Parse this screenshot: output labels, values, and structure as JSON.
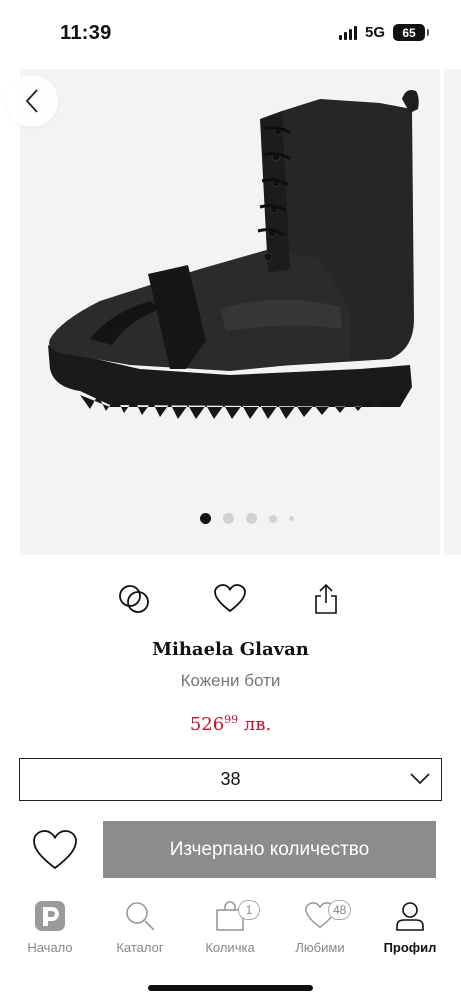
{
  "status_bar": {
    "time": "11:39",
    "network": "5G",
    "battery": "65"
  },
  "gallery": {
    "image_description_icon": "boot-image",
    "dots_count": 5,
    "active_dot": 0
  },
  "product": {
    "brand": "Mihaela Glavan",
    "name": "Кожени боти",
    "price_main": "526",
    "price_cents": "99",
    "price_currency": " лв.",
    "price_color": "#c8102e"
  },
  "size_select": {
    "selected": "38"
  },
  "buy": {
    "button_label": "Изчерпано количество"
  },
  "tabs": [
    {
      "label": "Начало",
      "icon": "home-logo-icon"
    },
    {
      "label": "Каталог",
      "icon": "search-icon"
    },
    {
      "label": "Количка",
      "icon": "bag-icon",
      "badge": "1"
    },
    {
      "label": "Любими",
      "icon": "heart-icon",
      "badge": "48"
    },
    {
      "label": "Профил",
      "icon": "user-icon",
      "active": true
    }
  ]
}
